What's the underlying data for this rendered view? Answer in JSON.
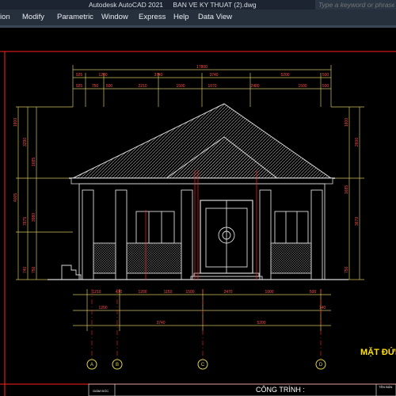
{
  "app": {
    "title_app": "Autodesk AutoCAD 2021",
    "title_file": "BAN VE KY THUAT (2).dwg",
    "search_placeholder": "Type a keyword or phrase"
  },
  "menu": {
    "items": [
      "ion",
      "Modify",
      "Parametric",
      "Window",
      "Express",
      "Help",
      "Data View"
    ]
  },
  "drawing": {
    "overall_width_dim": "17800",
    "top_dims_row1": [
      "925",
      "1200",
      "3740",
      "3740",
      "5200",
      "500"
    ],
    "top_dims_row2": [
      "925",
      "750",
      "500",
      "2210",
      "1500",
      "1070",
      "2480",
      "1500",
      "500"
    ],
    "left_dims": [
      "1800",
      "4005",
      "3290",
      "1685",
      "7875",
      "3980",
      "740",
      "750"
    ],
    "right_dims": [
      "1800",
      "2600",
      "1685",
      "3670",
      "750"
    ],
    "bottom_dims_row1": [
      "1210",
      "470",
      "1200",
      "1150",
      "1500",
      "2470",
      "1000",
      "500"
    ],
    "bottom_dims_row2": [
      "1200",
      "3740",
      "5200",
      "740"
    ],
    "axis_labels": [
      "A",
      "B",
      "C",
      "D"
    ],
    "view_title": "MẶT ĐỨN",
    "titleblock_project_label": "CÔNG TRÌNH :",
    "titleblock_small_left": "GIÁM ĐỐC",
    "titleblock_small_right": "TÊN BẢN"
  },
  "colors": {
    "background": "#000000",
    "dim_line": "#cfc35a",
    "dim_text": "#ff4d4d",
    "red_line": "#ff2020",
    "building": "#d9d9d9",
    "roof_hatch": "#9a9a9a",
    "axis_circle": "#e0d24a",
    "view_title": "#ffe100",
    "menu_bg": "#26303c",
    "title_bg": "#1b2430"
  }
}
